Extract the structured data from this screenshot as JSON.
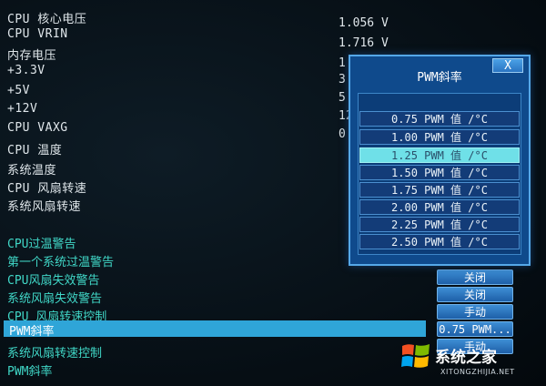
{
  "hardware_monitor": {
    "rows": [
      {
        "label": "CPU 核心电压",
        "value": "1.056 V"
      },
      {
        "label": "CPU VRIN",
        "value": "1.716 V"
      },
      {
        "label": "内存电压",
        "value": "1"
      },
      {
        "label": "+3.3V",
        "value": "3"
      },
      {
        "label": "+5V",
        "value": "5"
      },
      {
        "label": "+12V",
        "value": "12"
      },
      {
        "label": "CPU VAXG",
        "value": "0"
      },
      {
        "label": "CPU 温度",
        "value": ""
      },
      {
        "label": "系统温度",
        "value": ""
      },
      {
        "label": "CPU 风扇转速",
        "value": ""
      },
      {
        "label": "系统风扇转速",
        "value": ""
      }
    ]
  },
  "options": {
    "rows": [
      {
        "label": "CPU过温警告",
        "value": ""
      },
      {
        "label": "第一个系统过温警告",
        "value": ""
      },
      {
        "label": "CPU风扇失效警告",
        "value": "关闭"
      },
      {
        "label": "系统风扇失效警告",
        "value": "关闭"
      },
      {
        "label": "CPU 风扇转速控制",
        "value": "手动"
      },
      {
        "label": "系统风扇转速控制",
        "value": "手动"
      },
      {
        "label": "PWM斜率",
        "value": ""
      }
    ],
    "selected": {
      "label": "PWM斜率",
      "value": "0.75 PWM..."
    }
  },
  "dialog": {
    "title": "PWM斜率",
    "close_label": "X",
    "options": [
      "0.75 PWM 值 /°C",
      "1.00 PWM 值 /°C",
      "1.25 PWM 值 /°C",
      "1.50 PWM 值 /°C",
      "1.75 PWM 值 /°C",
      "2.00 PWM 值 /°C",
      "2.25 PWM 值 /°C",
      "2.50 PWM 值 /°C"
    ],
    "highlighted_index": 2
  },
  "watermark": {
    "text": "系统之家",
    "url": "XITONGZHIJIA.NET",
    "icon": "windows-flag-icon"
  },
  "colors": {
    "option_text": "#40d7c7",
    "selection_bar": "#2fa5d8",
    "dialog_bg": "#0f4a8c",
    "highlight": "#6fe0e8"
  }
}
